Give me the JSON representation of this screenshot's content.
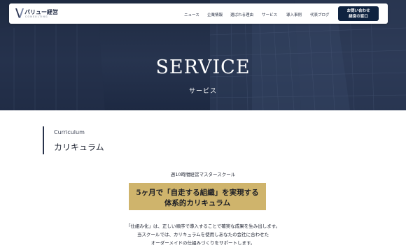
{
  "brand": {
    "name": "バリュー経営",
    "sub": "CONSULTING"
  },
  "nav": {
    "items": [
      {
        "label": "ニュース"
      },
      {
        "label": "企業情報"
      },
      {
        "label": "選ばれる理由"
      },
      {
        "label": "サービス"
      },
      {
        "label": "導入事例"
      },
      {
        "label": "代表ブログ"
      }
    ],
    "contact_line1": "お問い合わせ",
    "contact_line2": "経営の窓口"
  },
  "hero": {
    "title": "SERVICE",
    "subtitle": "サービス"
  },
  "section": {
    "label_en": "Curriculum",
    "label_jp": "カリキュラム"
  },
  "content": {
    "tagline": "週10時間経営マスタースクール",
    "highlight_line1": "5ヶ月で「自走する組織」を実現する",
    "highlight_line2": "体系的カリキュラム",
    "desc_lines": [
      "「仕組み化」は、正しい順序で導入することで確実な成果を生み出します。",
      "当スクールでは、カリキュラムを使用しあなたの会社に合わせた",
      "オーダーメイドの仕組みづくりをサポートします。"
    ]
  },
  "colors": {
    "navy": "#0f2340",
    "gold": "#cfb46c"
  }
}
